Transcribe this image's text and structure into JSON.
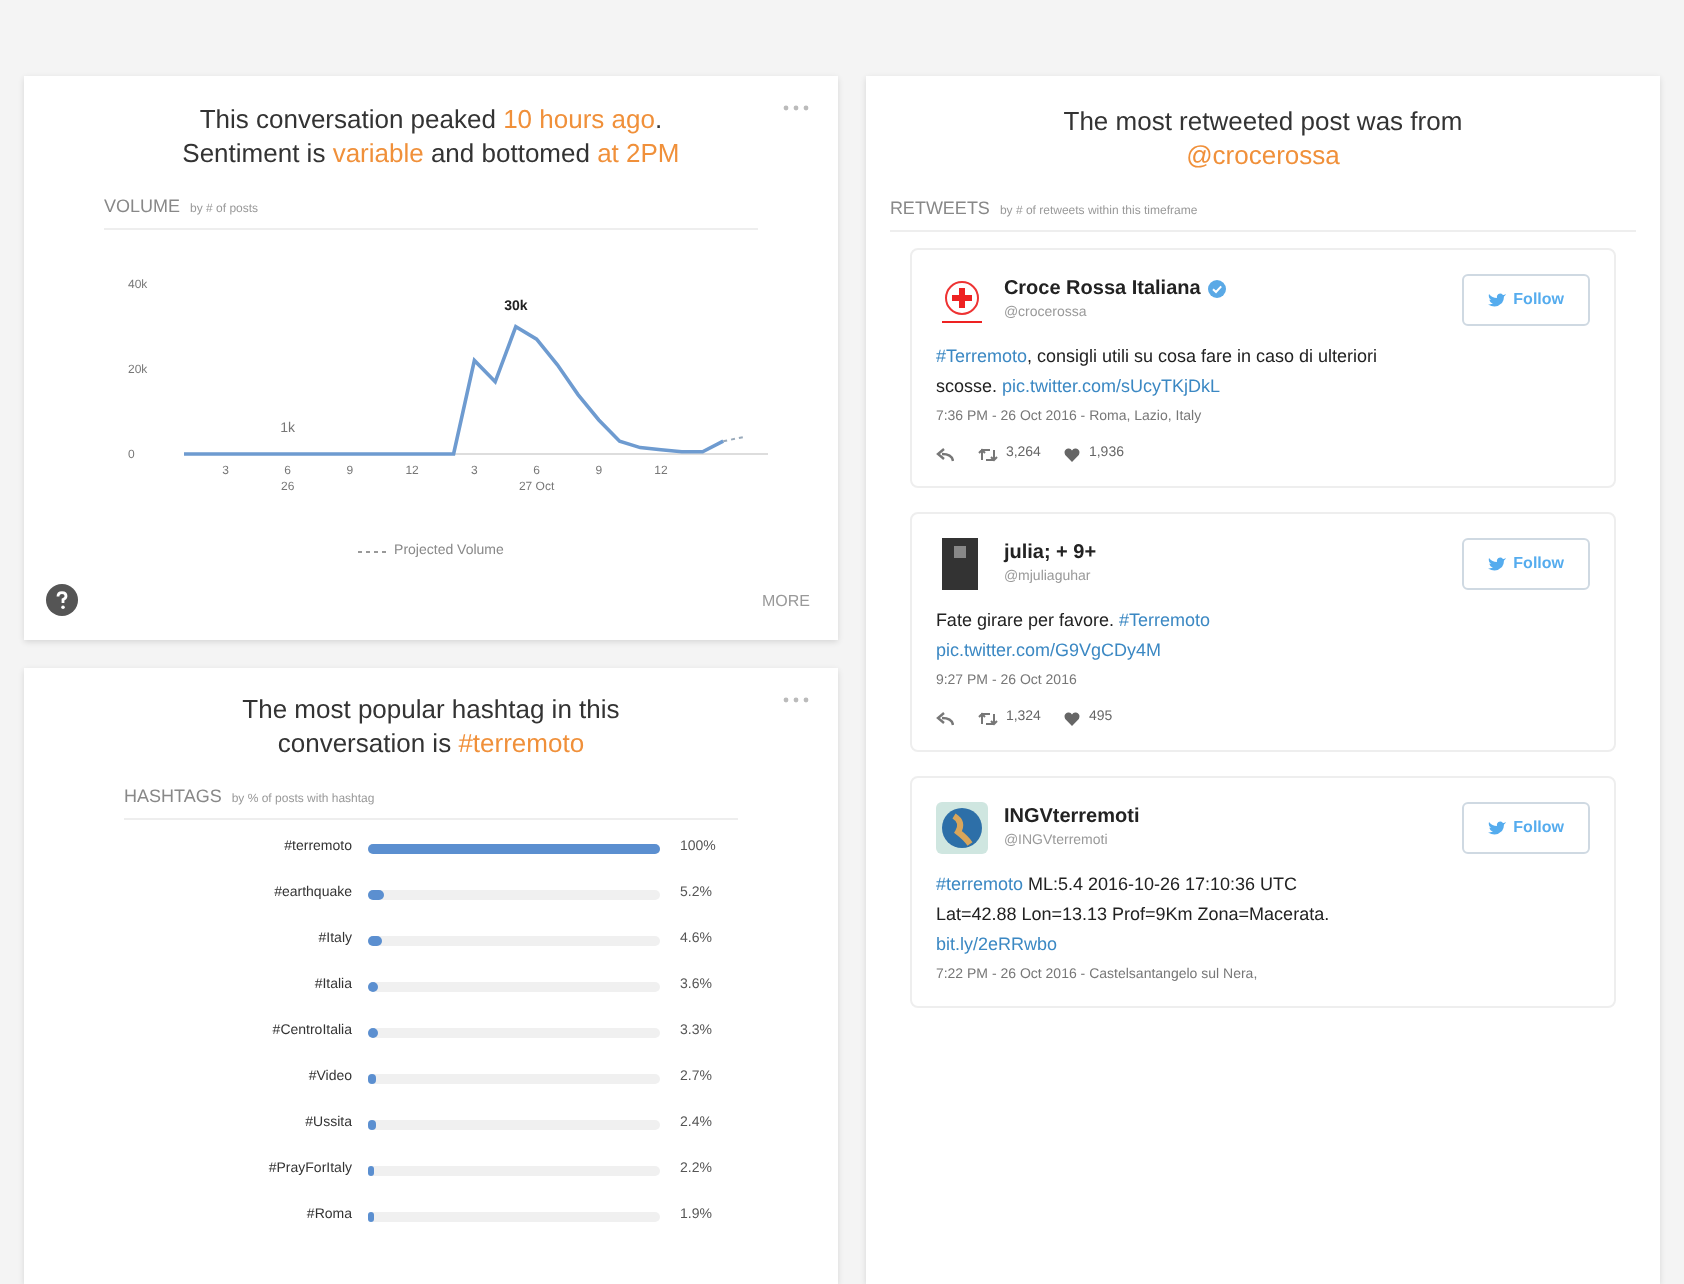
{
  "volume_card": {
    "headline": [
      {
        "text": "This conversation peaked ",
        "highlight": false
      },
      {
        "text": "10 hours ago",
        "highlight": true
      },
      {
        "text": ".\nSentiment is ",
        "highlight": false
      },
      {
        "text": "variable",
        "highlight": true
      },
      {
        "text": " and bottomed ",
        "highlight": false
      },
      {
        "text": "at 2PM",
        "highlight": true
      }
    ],
    "section_title": "VOLUME",
    "section_subtitle": "by # of posts",
    "chart_data": {
      "type": "line",
      "categories": [
        null,
        null,
        "3",
        null,
        null,
        "6\n26",
        null,
        null,
        "9",
        null,
        null,
        "12",
        null,
        null,
        "3",
        null,
        null,
        "6\n27 Oct",
        null,
        null,
        "9",
        null,
        null,
        "12",
        null,
        null,
        null,
        null
      ],
      "series": [
        {
          "color": "#6e9bd0",
          "values": [
            0,
            0,
            0,
            0,
            0,
            0,
            0,
            0,
            0,
            0,
            0,
            0,
            0,
            0,
            22000,
            17000,
            30000,
            27000,
            21000,
            14000,
            8000,
            3000,
            1500,
            1000,
            500,
            500,
            3000,
            null
          ]
        },
        {
          "name": "Projected Volume",
          "color": "#99aabb",
          "line_style": "dashed",
          "values": [
            null,
            null,
            null,
            null,
            null,
            null,
            null,
            null,
            null,
            null,
            null,
            null,
            null,
            null,
            null,
            null,
            null,
            null,
            null,
            null,
            null,
            null,
            null,
            null,
            null,
            null,
            3000,
            4000
          ]
        }
      ],
      "ylim": [
        0,
        40000
      ],
      "yticks": [
        {
          "value": 0,
          "label": "0"
        },
        {
          "value": 20000,
          "label": "20k"
        },
        {
          "value": 40000,
          "label": "40k"
        }
      ],
      "annotations": [
        {
          "x": "6\n26",
          "y": 1000,
          "text": "1k"
        },
        {
          "y": 30000,
          "text": "30k"
        }
      ]
    },
    "more": "MORE"
  },
  "hashtag_card": {
    "headline": [
      {
        "text": "The most popular hashtag in this\nconversation is ",
        "highlight": false
      },
      {
        "text": "#terremoto",
        "highlight": true
      }
    ],
    "section_title": "HASHTAGS",
    "section_subtitle": "by % of posts with hashtag",
    "rows": [
      {
        "label": "#terremoto",
        "level": 1.0,
        "value": "100%"
      },
      {
        "label": "#earthquake",
        "level": 0.052,
        "value": "5.2%"
      },
      {
        "label": "#Italy",
        "level": 0.046,
        "value": "4.6%"
      },
      {
        "label": "#Italia",
        "level": 0.036,
        "value": "3.6%"
      },
      {
        "label": "#CentroItalia",
        "level": 0.033,
        "value": "3.3%"
      },
      {
        "label": "#Video",
        "level": 0.027,
        "value": "2.7%"
      },
      {
        "label": "#Ussita",
        "level": 0.024,
        "value": "2.4%"
      },
      {
        "label": "#PrayForItaly",
        "level": 0.022,
        "value": "2.2%"
      },
      {
        "label": "#Roma",
        "level": 0.019,
        "value": "1.9%"
      }
    ]
  },
  "retweets_card": {
    "headline": [
      {
        "text": "The most retweeted post was from\n",
        "highlight": false
      },
      {
        "text": "@crocerossa",
        "highlight": true
      }
    ],
    "section_title": "RETWEETS",
    "section_subtitle": "by # of retweets within this timeframe",
    "tweets": [
      {
        "kind": "cross",
        "name": "Croce Rossa Italiana",
        "verified": true,
        "handle": "@crocerossa",
        "follow": "Follow",
        "text": [
          {
            "text": "#Terremoto",
            "link": true
          },
          {
            "text": ", consigli utili su cosa fare in caso di ulteriori scosse. ",
            "link": false
          },
          {
            "text": "pic.twitter.com/sUcyTKjDkL",
            "link": true
          }
        ],
        "meta": "7:36 PM - 26 Oct 2016 - Roma, Lazio, Italy",
        "retweets": "3,264",
        "likes": "1,936"
      },
      {
        "kind": "photo",
        "name": "julia; + 9+",
        "verified": false,
        "handle": "@mjuliaguhar",
        "follow": "Follow",
        "text": [
          {
            "text": "Fate girare per favore. ",
            "link": false
          },
          {
            "text": "#Terremoto ",
            "link": true
          },
          {
            "text": "pic.twitter.com/G9VgCDy4M",
            "link": true
          }
        ],
        "meta": "9:27 PM - 26 Oct 2016",
        "retweets": "1,324",
        "likes": "495"
      },
      {
        "kind": "globe",
        "name": "INGVterremoti",
        "verified": false,
        "handle": "@INGVterremoti",
        "follow": "Follow",
        "text": [
          {
            "text": "#terremoto",
            "link": true
          },
          {
            "text": " ML:5.4 2016-10-26 17:10:36 UTC Lat=42.88 Lon=13.13 Prof=9Km Zona=Macerata. ",
            "link": false
          },
          {
            "text": "bit.ly/2eRRwbo",
            "link": true
          }
        ],
        "meta": "7:22 PM - 26 Oct 2016 - Castelsantangelo sul Nera,"
      }
    ]
  }
}
